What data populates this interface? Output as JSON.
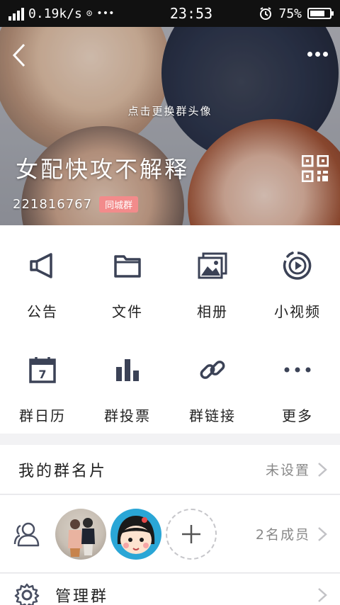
{
  "status_bar": {
    "network_type": "4G",
    "speed": "0.19k/s",
    "time": "23:53",
    "battery_percent": "75%",
    "battery_level": 0.75
  },
  "header": {
    "change_avatar_hint": "点击更换群头像",
    "group_name": "女配快攻不解释",
    "group_id": "221816767",
    "badge": "同城群"
  },
  "functions": [
    {
      "label": "公告",
      "icon": "megaphone-icon"
    },
    {
      "label": "文件",
      "icon": "folder-icon"
    },
    {
      "label": "相册",
      "icon": "album-icon"
    },
    {
      "label": "小视频",
      "icon": "video-icon"
    },
    {
      "label": "群日历",
      "icon": "calendar-icon"
    },
    {
      "label": "群投票",
      "icon": "vote-icon"
    },
    {
      "label": "群链接",
      "icon": "link-icon"
    },
    {
      "label": "更多",
      "icon": "more-dots-icon"
    }
  ],
  "calendar_day": "7",
  "group_card": {
    "title": "我的群名片",
    "value": "未设置"
  },
  "members": {
    "count_label": "2名成员"
  },
  "manage": {
    "title": "管理群"
  },
  "colors": {
    "icon": "#3b4256",
    "badge": "#f28b8b",
    "divider": "#e3e3e6"
  }
}
